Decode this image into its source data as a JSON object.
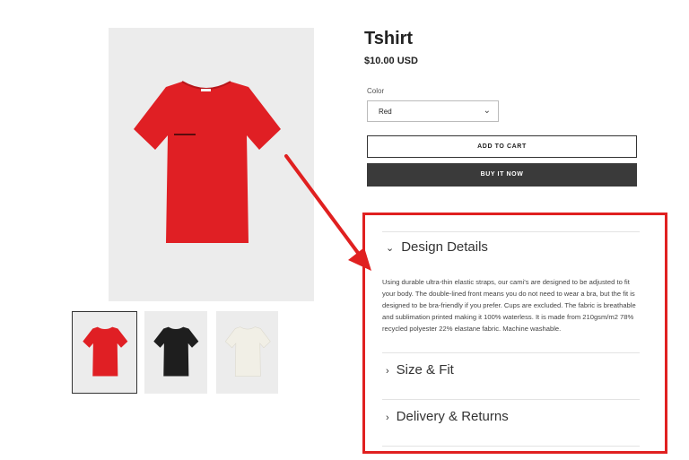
{
  "product": {
    "title": "Tshirt",
    "price": "$10.00 USD",
    "color_label": "Color",
    "color_value": "Red",
    "add_to_cart": "ADD TO CART",
    "buy_now": "BUY IT NOW"
  },
  "gallery": {
    "thumbnails": [
      "red-tshirt",
      "black-tshirt",
      "white-tshirt"
    ],
    "colors": {
      "red": "#e01f24",
      "black": "#1e1e1e",
      "white": "#f1efe6"
    }
  },
  "accordion": [
    {
      "label": "Design Details",
      "icon": "chevron-down-icon"
    },
    {
      "label": "Size & Fit",
      "icon": "chevron-right-icon"
    },
    {
      "label": "Delivery & Returns",
      "icon": "chevron-right-icon"
    }
  ],
  "design_details_text": "Using durable ultra-thin elastic straps, our cami's are designed to be adjusted to fit your body. The double-lined front means you do not need to wear a bra, but the fit is designed to be bra-friendly if you prefer. Cups are excluded. The fabric is breathable and sublimation printed making it 100% waterless. It is made from 210gsm/m2 78% recycled polyester 22% elastane fabric. Machine washable.",
  "annotation": {
    "color": "#e02020"
  }
}
